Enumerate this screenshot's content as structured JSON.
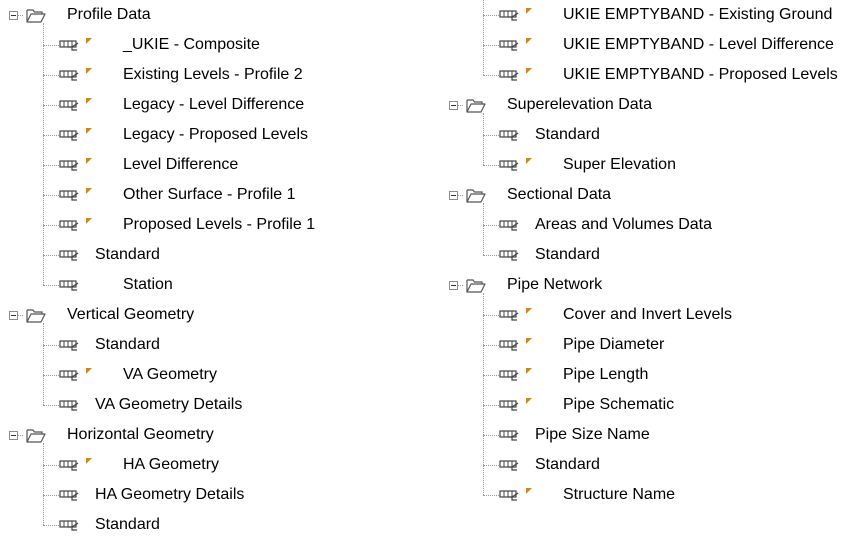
{
  "left_column": [
    {
      "type": "folder",
      "label": "Profile Data"
    },
    {
      "type": "item",
      "label": "_UKIE - Composite",
      "marked": true
    },
    {
      "type": "item",
      "label": "Existing Levels - Profile 2",
      "marked": true
    },
    {
      "type": "item",
      "label": "Legacy - Level Difference",
      "marked": true
    },
    {
      "type": "item",
      "label": "Legacy - Proposed Levels",
      "marked": true
    },
    {
      "type": "item",
      "label": "Level Difference",
      "marked": true
    },
    {
      "type": "item",
      "label": "Other Surface - Profile 1",
      "marked": true
    },
    {
      "type": "item",
      "label": "Proposed Levels - Profile 1",
      "marked": true
    },
    {
      "type": "item",
      "label": "Standard",
      "marked": false
    },
    {
      "type": "item",
      "label": "Station",
      "marked": false,
      "label_indent": true
    },
    {
      "type": "folder",
      "label": "Vertical Geometry"
    },
    {
      "type": "item",
      "label": "Standard",
      "marked": false
    },
    {
      "type": "item",
      "label": "VA Geometry",
      "marked": true
    },
    {
      "type": "item",
      "label": "VA Geometry Details",
      "marked": false
    },
    {
      "type": "folder",
      "label": "Horizontal Geometry"
    },
    {
      "type": "item",
      "label": "HA Geometry",
      "marked": true
    },
    {
      "type": "item",
      "label": "HA Geometry Details",
      "marked": false
    },
    {
      "type": "item",
      "label": "Standard",
      "marked": false
    }
  ],
  "right_column": [
    {
      "type": "item",
      "label": "UKIE EMPTYBAND - Existing Ground",
      "marked": true
    },
    {
      "type": "item",
      "label": "UKIE EMPTYBAND - Level Difference",
      "marked": true
    },
    {
      "type": "item",
      "label": "UKIE EMPTYBAND - Proposed Levels",
      "marked": true
    },
    {
      "type": "folder",
      "label": "Superelevation Data"
    },
    {
      "type": "item",
      "label": "Standard",
      "marked": false
    },
    {
      "type": "item",
      "label": "Super Elevation",
      "marked": true
    },
    {
      "type": "folder",
      "label": "Sectional Data"
    },
    {
      "type": "item",
      "label": "Areas and Volumes Data",
      "marked": false
    },
    {
      "type": "item",
      "label": "Standard",
      "marked": false
    },
    {
      "type": "folder",
      "label": "Pipe Network"
    },
    {
      "type": "item",
      "label": "Cover and Invert Levels",
      "marked": true
    },
    {
      "type": "item",
      "label": "Pipe Diameter",
      "marked": true
    },
    {
      "type": "item",
      "label": "Pipe Length",
      "marked": true
    },
    {
      "type": "item",
      "label": "Pipe Schematic",
      "marked": true
    },
    {
      "type": "item",
      "label": "Pipe Size Name",
      "marked": false
    },
    {
      "type": "item",
      "label": "Standard",
      "marked": false
    },
    {
      "type": "item",
      "label": "Structure Name",
      "marked": true
    }
  ],
  "icons": {
    "folder": "folder-open-icon",
    "item": "band-style-icon",
    "marker": "modified-marker-icon",
    "expander": "collapse-icon"
  },
  "colors": {
    "marker": "#d4880f",
    "icon_stroke": "#444444",
    "tree_lines": "#9a9a9a",
    "text": "#000000"
  }
}
